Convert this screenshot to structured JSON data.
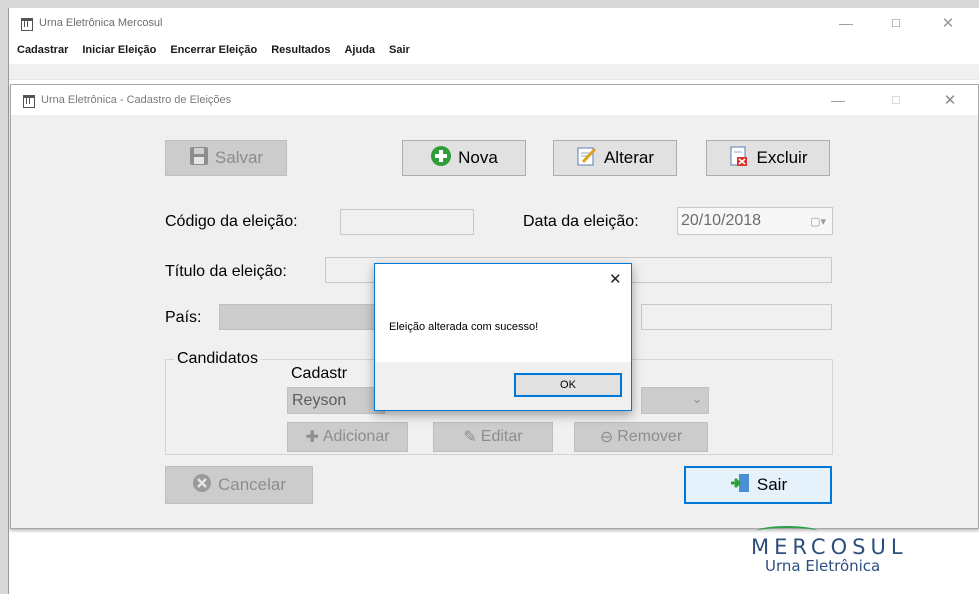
{
  "main_window": {
    "title": "Urna Eletrônica Mercosul",
    "controls": {
      "minimize": "—",
      "maximize": "☐",
      "close": "✕"
    },
    "menu": [
      "Cadastrar",
      "Iniciar Eleição",
      "Encerrar Eleição",
      "Resultados",
      "Ajuda",
      "Sair"
    ]
  },
  "child_window": {
    "title": "Urna Eletrônica - Cadastro de Eleições",
    "controls": {
      "minimize": "—",
      "maximize": "☐",
      "close": "✕"
    },
    "toolbar": {
      "salvar": "Salvar",
      "nova": "Nova",
      "alterar": "Alterar",
      "excluir": "Excluir"
    },
    "form": {
      "codigo_label": "Código da eleição:",
      "codigo_value": "",
      "data_label": "Data da eleição:",
      "data_value": "20/10/2018",
      "titulo_label": "Título da eleição:",
      "titulo_value": "",
      "pais_label": "País:",
      "pais_value": ""
    },
    "candidatos": {
      "group_label": "Candidatos",
      "cadastro_label": "Cadastr",
      "combo_value": "Reyson",
      "adicionar": "Adicionar",
      "editar": "Editar",
      "remover": "Remover"
    },
    "cancelar": "Cancelar",
    "sair": "Sair"
  },
  "dialog": {
    "close": "✕",
    "message": "Eleição alterada com sucesso!",
    "ok": "OK"
  },
  "logo": {
    "title": "MERCOSUL",
    "subtitle": "Urna Eletrônica"
  },
  "colors": {
    "accent": "#0078d7",
    "logo_blue": "#2e4f7e",
    "logo_green": "#2aa04a",
    "disabled_bg": "#cccccc"
  }
}
